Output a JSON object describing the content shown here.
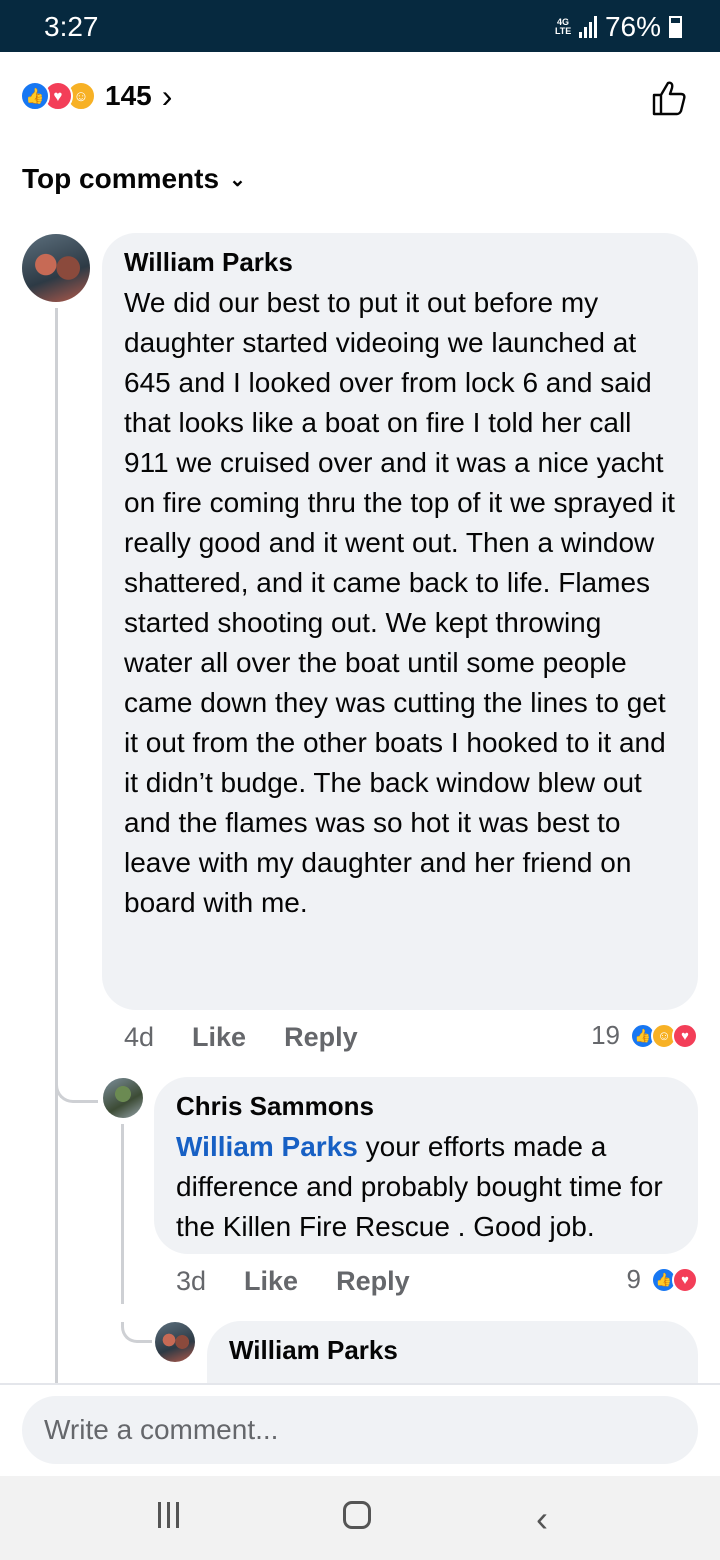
{
  "status_bar": {
    "time": "3:27",
    "network": "4G LTE",
    "battery": "76%"
  },
  "reactions": {
    "count": "145",
    "chevron": "›",
    "icons": [
      "like-icon",
      "love-icon",
      "care-icon"
    ]
  },
  "section": {
    "label": "Top comments",
    "chevron": "⌄"
  },
  "comments": [
    {
      "author": "William Parks",
      "text": "We did our best to put it out before my daughter started videoing we launched at 645 and I looked over from lock 6 and said that looks like a boat on fire  I told her call 911 we cruised over and it was a nice yacht on fire coming thru the top of it we sprayed it really good and it went out. Then a window shattered, and it came back to life. Flames started shooting out. We kept throwing water all over the boat until some people came down  they was cutting the lines to get it out from the other boats I hooked to it and it didn’t budge. The back window blew out and the flames was so hot it was best to leave with my daughter and her friend on board with me.",
      "time": "4d",
      "like": "Like",
      "reply": "Reply",
      "reaction_count": "19"
    },
    {
      "author": "Chris Sammons",
      "mention": "William Parks",
      "text": " your efforts made a difference and probably bought time for the Killen Fire Rescue . Good job.",
      "time": "3d",
      "like": "Like",
      "reply": "Reply",
      "reaction_count": "9"
    },
    {
      "author": "William Parks"
    }
  ],
  "composer": {
    "placeholder": "Write a comment..."
  },
  "colors": {
    "accent": "#1877f2",
    "mention": "#1760c4",
    "status_bar": "#06293f",
    "bubble": "#f0f2f5"
  }
}
